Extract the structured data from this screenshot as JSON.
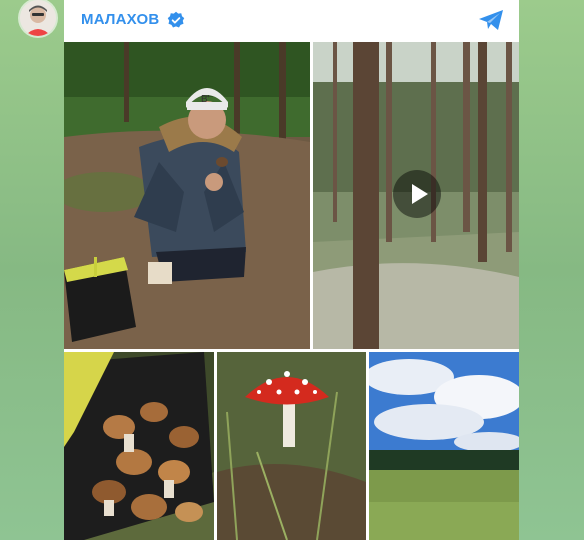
{
  "channel": {
    "name": "МАЛАХОВ",
    "verified": true
  },
  "icons": {
    "verified": "verified-badge-icon",
    "share": "telegram-share-icon",
    "play": "play-icon"
  },
  "colors": {
    "accent": "#3390ec",
    "background": "#8fbf86"
  },
  "media": [
    {
      "kind": "photo",
      "subject": "man-picking-mushroom"
    },
    {
      "kind": "video",
      "subject": "pine-forest"
    },
    {
      "kind": "photo",
      "subject": "basket-of-mushrooms"
    },
    {
      "kind": "photo",
      "subject": "fly-agaric"
    },
    {
      "kind": "photo",
      "subject": "meadow-and-sky"
    }
  ]
}
